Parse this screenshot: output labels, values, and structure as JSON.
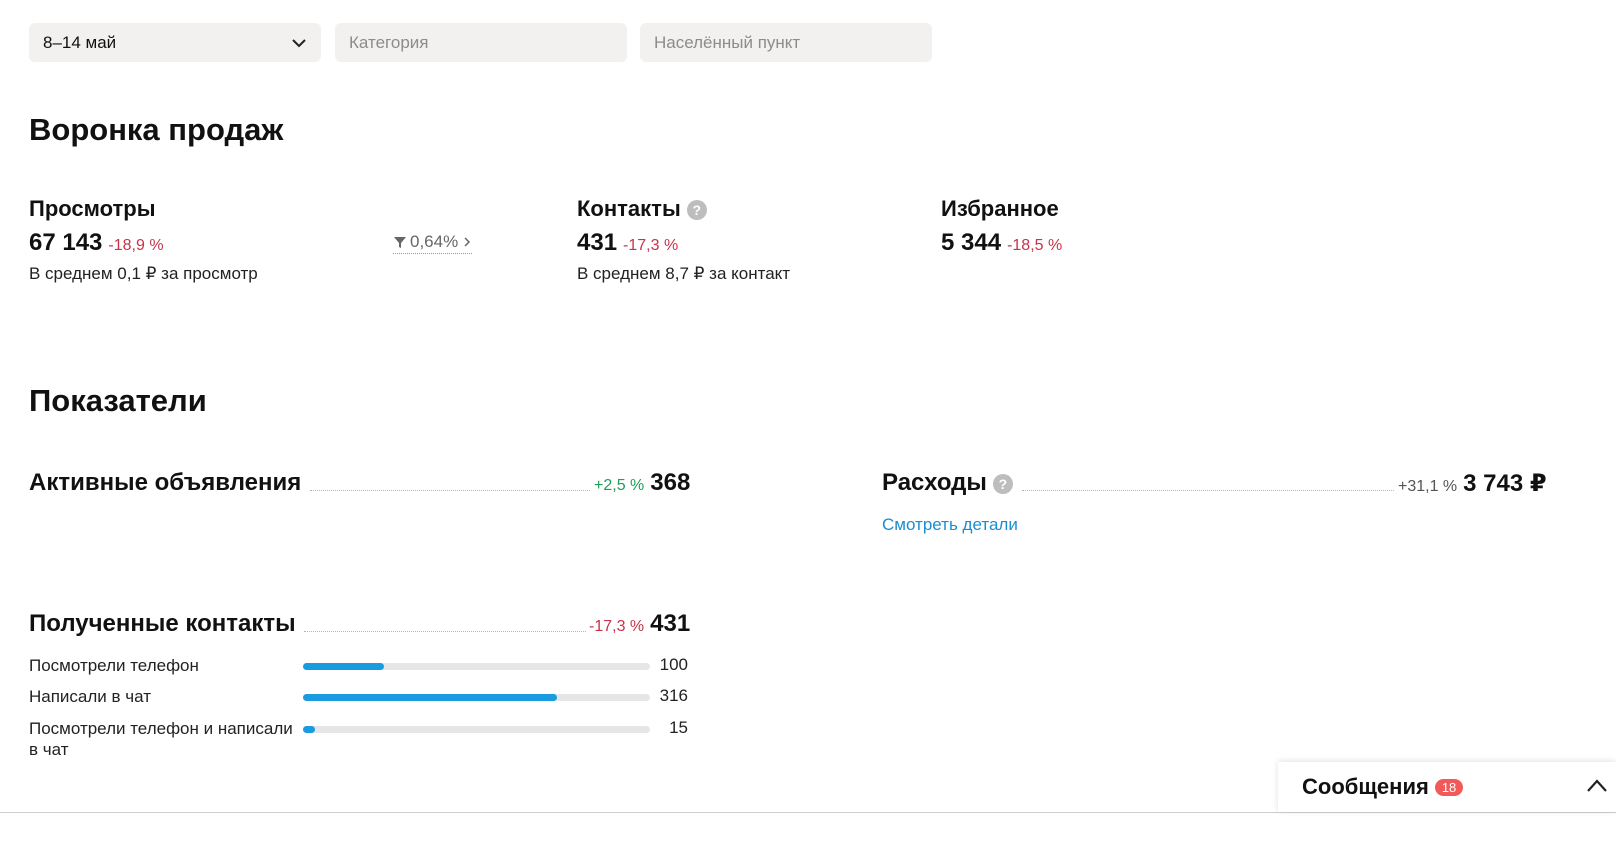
{
  "filters": {
    "period": "8–14 май",
    "category_placeholder": "Категория",
    "location_placeholder": "Населённый пункт"
  },
  "funnel": {
    "heading": "Воронка продаж",
    "views": {
      "title": "Просмотры",
      "value": "67 143",
      "delta": "-18,9 %",
      "sub": "В среднем 0,1 ₽ за просмотр"
    },
    "conversion": "0,64%",
    "contacts": {
      "title": "Контакты",
      "value": "431",
      "delta": "-17,3 %",
      "sub": "В среднем 8,7 ₽ за контакт"
    },
    "favorites": {
      "title": "Избранное",
      "value": "5 344",
      "delta": "-18,5 %"
    }
  },
  "indicators": {
    "heading": "Показатели",
    "active_ads": {
      "title": "Активные объявления",
      "delta": "+2,5 %",
      "value": "368"
    },
    "expenses": {
      "title": "Расходы",
      "delta": "+31,1 %",
      "value": "3 743 ₽",
      "link": "Смотреть детали"
    },
    "contacts_received": {
      "title": "Полученные контакты",
      "delta": "-17,3 %",
      "value": "431",
      "rows": [
        {
          "label": "Посмотрели телефон",
          "count": "100",
          "fraction": 0.232
        },
        {
          "label": "Написали в чат",
          "count": "316",
          "fraction": 0.733
        },
        {
          "label": "Посмотрели телефон и написали в чат",
          "count": "15",
          "fraction": 0.035
        }
      ]
    }
  },
  "messages": {
    "title": "Сообщения",
    "badge": "18"
  },
  "colors": {
    "negative": "#c8334a",
    "positive": "#1e9d55",
    "accent": "#1a9be0",
    "link": "#1a8ed0",
    "badge": "#f25a5a"
  }
}
